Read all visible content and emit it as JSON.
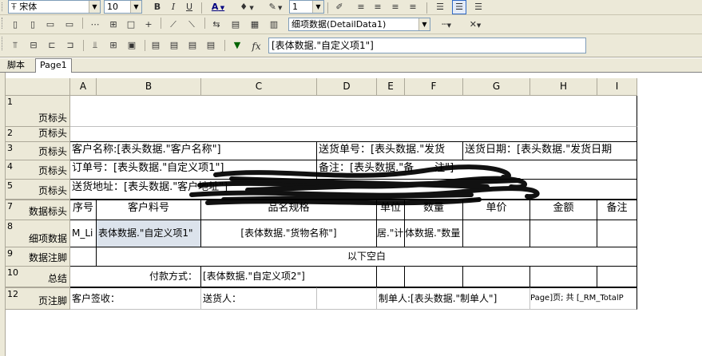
{
  "toolbar1": {
    "font_name": "宋体",
    "font_size": "10",
    "bold": "B",
    "italic": "I",
    "underline": "U",
    "font_color_label": "A",
    "border_width": "1"
  },
  "toolbar2": {
    "band_select": "细项数据(DetailData1)"
  },
  "toolbar3": {
    "fx_label": "fx",
    "formula": "[表体数据.\"自定义项1\"]"
  },
  "tabs": [
    {
      "label": "脚本",
      "active": false
    },
    {
      "label": "Page1",
      "active": true
    }
  ],
  "columns": [
    "A",
    "B",
    "C",
    "D",
    "E",
    "F",
    "G",
    "H",
    "I"
  ],
  "rows": [
    {
      "num": "1",
      "name": "页标头"
    },
    {
      "num": "2",
      "name": "页标头"
    },
    {
      "num": "3",
      "name": "页标头"
    },
    {
      "num": "4",
      "name": "页标头"
    },
    {
      "num": "5",
      "name": "页标头"
    },
    {
      "num": "7",
      "name": "数据标头"
    },
    {
      "num": "8",
      "name": "细项数据"
    },
    {
      "num": "9",
      "name": "数据注脚"
    },
    {
      "num": "10",
      "name": "总结"
    },
    {
      "num": "12",
      "name": "页注脚"
    }
  ],
  "cells": {
    "r3_customer": "客户名称:[表头数据.\"客户名称\"]",
    "r3_delivery_no": "送货单号：[表头数据.\"发货",
    "r3_delivery_date": "送货日期：[表头数据.\"发货日期",
    "r4_order_no": "订单号：[表头数据.\"自定义项1\"]",
    "r4_remark": "备注：[表头数据.\"备　　注\"]",
    "r5_address": "送货地址：[表头数据.\"客户地址\"]",
    "h_seq": "序号",
    "h_cust_item": "客户料号",
    "h_spec": "品名规格",
    "h_unit": "单位",
    "h_qty": "数量",
    "h_price": "单价",
    "h_amount": "金额",
    "h_note": "备注",
    "d_seq": "M_Li",
    "d_cust_item": "表体数据.\"自定义项1\"",
    "d_spec": "[表体数据.\"货物名称\"]",
    "d_unit": "居.\"计",
    "d_qty": "体数据.\"数量",
    "blank_below": "以下空白",
    "pay_label": "付款方式：",
    "pay_value": "[表体数据.\"自定义项2\"]",
    "f_sign": "客户签收：",
    "f_sender": "送货人：",
    "f_maker": "制单人:[表头数据.\"制单人\"]",
    "f_pages": "Page]页; 共 [_RM_TotalP"
  }
}
